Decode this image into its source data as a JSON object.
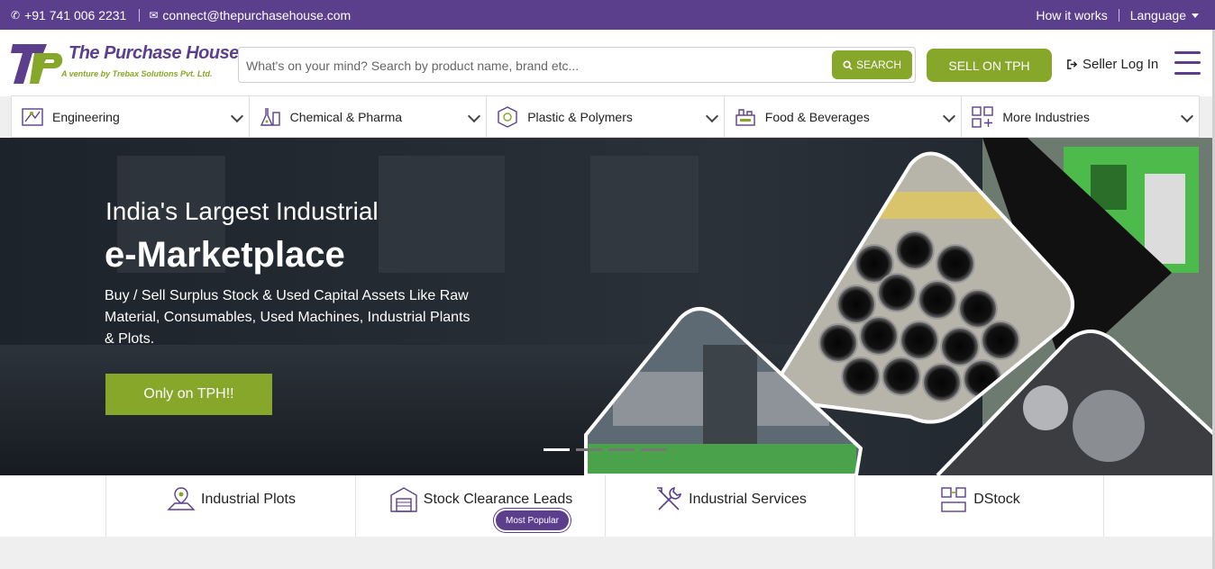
{
  "topbar": {
    "phone": "+91 741 006 2231",
    "email": "connect@thepurchasehouse.com",
    "how_it_works": "How it works",
    "language": "Language"
  },
  "header": {
    "brand": "The Purchase House",
    "tagline": "A venture by Trebax Solutions Pvt. Ltd.",
    "search_placeholder": "What's on your mind? Search by product name, brand etc...",
    "search_button": "SEARCH",
    "sell_button": "SELL ON TPH",
    "seller_login": "Seller Log In"
  },
  "categories": [
    {
      "label": "Engineering",
      "icon": "engineering-icon"
    },
    {
      "label": "Chemical & Pharma",
      "icon": "chemical-icon"
    },
    {
      "label": "Plastic & Polymers",
      "icon": "plastic-icon"
    },
    {
      "label": "Food & Beverages",
      "icon": "food-icon"
    },
    {
      "label": "More Industries",
      "icon": "grid-plus-icon"
    }
  ],
  "hero": {
    "title_line1": "India's Largest Industrial",
    "title_line2": "e-Marketplace",
    "description": "Buy / Sell Surplus Stock & Used Capital Assets Like Raw Material, Consumables, Used Machines, Industrial Plants & Plots.",
    "cta": "Only on TPH!!",
    "slides": 4,
    "active_slide": 1
  },
  "features": [
    {
      "label": "Industrial Plots",
      "icon": "plot-icon"
    },
    {
      "label": "Stock Clearance Leads",
      "icon": "warehouse-icon",
      "badge": "Most Popular"
    },
    {
      "label": "Industrial Services",
      "icon": "tools-icon"
    },
    {
      "label": "DStock",
      "icon": "dstock-icon"
    }
  ],
  "colors": {
    "brand_purple": "#5b3f8d",
    "accent_green": "#86a72a"
  }
}
